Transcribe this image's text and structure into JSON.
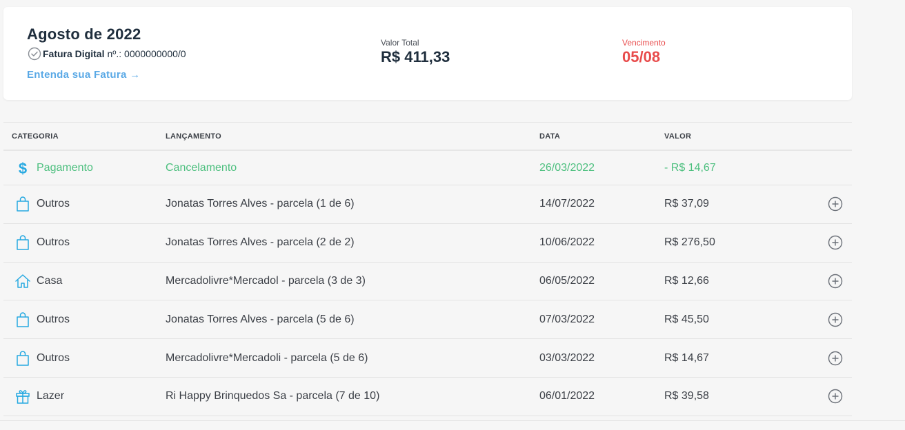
{
  "header": {
    "month_title": "Agosto de 2022",
    "fatura_label": "Fatura Digital",
    "fatura_number": "nº.: 0000000000/0",
    "entenda_link": "Entenda sua Fatura →",
    "total_label": "Valor Total",
    "total_value": "R$ 411,33",
    "due_label": "Vencimento",
    "due_value": "05/08"
  },
  "table": {
    "columns": {
      "categoria": "CATEGORIA",
      "lancamento": "LANÇAMENTO",
      "data": "DATA",
      "valor": "VALOR"
    },
    "rows": [
      {
        "category": "Pagamento",
        "icon": "dollar-icon",
        "description": "Cancelamento",
        "date": "26/03/2022",
        "value": "- R$ 14,67"
      },
      {
        "category": "Outros",
        "icon": "shopping-bag-icon",
        "description": "Jonatas Torres Alves - parcela (1 de 6)",
        "date": "14/07/2022",
        "value": "R$ 37,09"
      },
      {
        "category": "Outros",
        "icon": "shopping-bag-icon",
        "description": "Jonatas Torres Alves - parcela (2 de 2)",
        "date": "10/06/2022",
        "value": "R$ 276,50"
      },
      {
        "category": "Casa",
        "icon": "house-icon",
        "description": "Mercadolivre*Mercadol - parcela (3 de 3)",
        "date": "06/05/2022",
        "value": "R$ 12,66"
      },
      {
        "category": "Outros",
        "icon": "shopping-bag-icon",
        "description": "Jonatas Torres Alves - parcela (5 de 6)",
        "date": "07/03/2022",
        "value": "R$ 45,50"
      },
      {
        "category": "Outros",
        "icon": "shopping-bag-icon",
        "description": "Mercadolivre*Mercadoli - parcela (5 de 6)",
        "date": "03/03/2022",
        "value": "R$ 14,67"
      },
      {
        "category": "Lazer",
        "icon": "gift-icon",
        "description": "Ri Happy Brinquedos Sa - parcela (7 de 10)",
        "date": "06/01/2022",
        "value": "R$ 39,58"
      }
    ]
  },
  "colors": {
    "accent_link": "#5aa9e6",
    "due_red": "#e84b4b",
    "payment_green": "#4cbf7e",
    "icon_blue": "#27a9e1",
    "title_navy": "#1f2e3d"
  }
}
